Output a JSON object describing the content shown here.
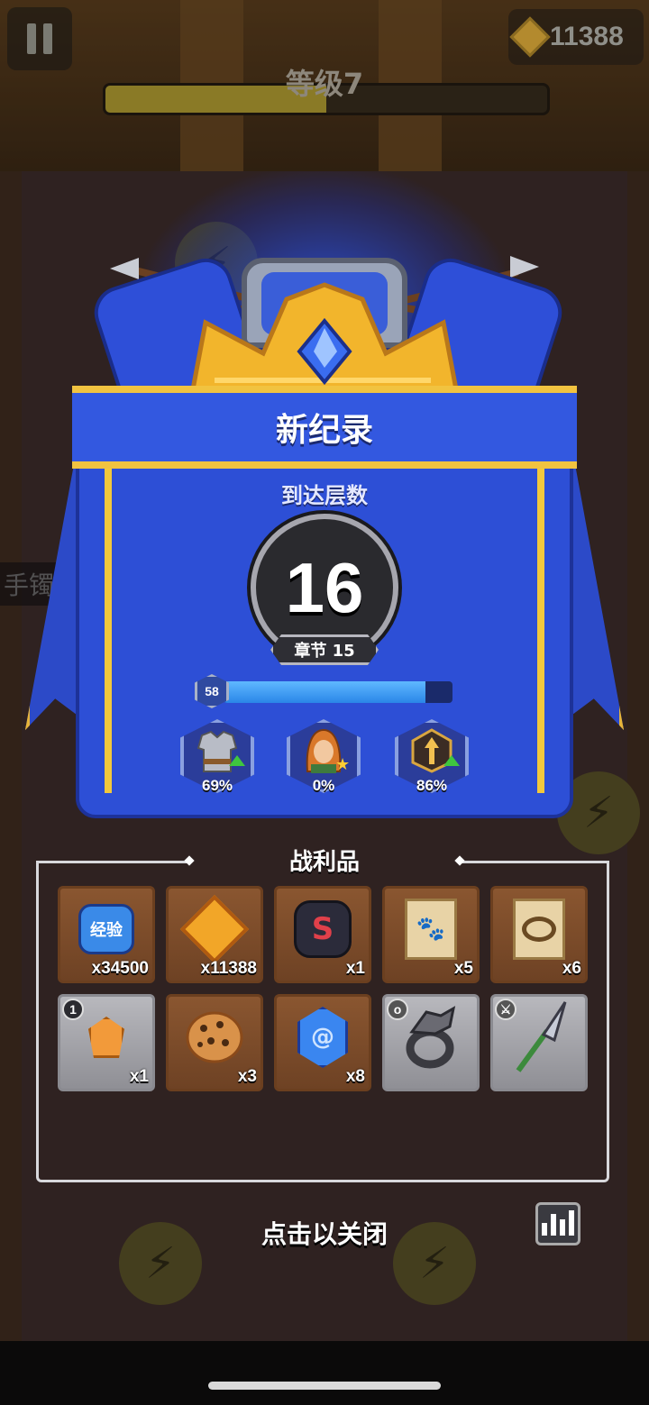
{
  "hud": {
    "coins": "11388",
    "level_label": "等级7",
    "level_progress": 0.5
  },
  "background": {
    "side_label": "手镯"
  },
  "record": {
    "title": "新纪录",
    "reached_label": "到达层数",
    "floor": "16",
    "chapter": "章节 15",
    "player_level": "58",
    "xp_progress": 0.88
  },
  "stats": [
    {
      "icon": "armor-icon",
      "value": "69%"
    },
    {
      "icon": "hero-portrait-icon",
      "value": "0%"
    },
    {
      "icon": "arrow-upgrade-icon",
      "value": "86%"
    }
  ],
  "loot": {
    "title": "战利品",
    "items": [
      {
        "icon": "exp-icon",
        "icon_text": "经验",
        "count": "x34500",
        "rarity": "common"
      },
      {
        "icon": "coin-bow-icon",
        "count": "x11388",
        "rarity": "common"
      },
      {
        "icon": "dark-rune-stone-icon",
        "count": "x1",
        "rarity": "common"
      },
      {
        "icon": "paw-scroll-icon",
        "count": "x5",
        "rarity": "common"
      },
      {
        "icon": "ring-scroll-icon",
        "count": "x6",
        "rarity": "common"
      },
      {
        "icon": "orange-gem-icon",
        "count": "x1",
        "rarity": "grey",
        "badge": "1"
      },
      {
        "icon": "cookie-icon",
        "count": "x3",
        "rarity": "common"
      },
      {
        "icon": "blue-crystal-icon",
        "count": "x8",
        "rarity": "common"
      },
      {
        "icon": "dragon-ring-icon",
        "count": "",
        "rarity": "grey"
      },
      {
        "icon": "spear-icon",
        "count": "",
        "rarity": "grey"
      }
    ]
  },
  "close_label": "点击以关闭",
  "colors": {
    "banner_blue": "#2d4fd6",
    "gold_trim": "#f1c340",
    "xp_fill": "#3a9cf5"
  }
}
